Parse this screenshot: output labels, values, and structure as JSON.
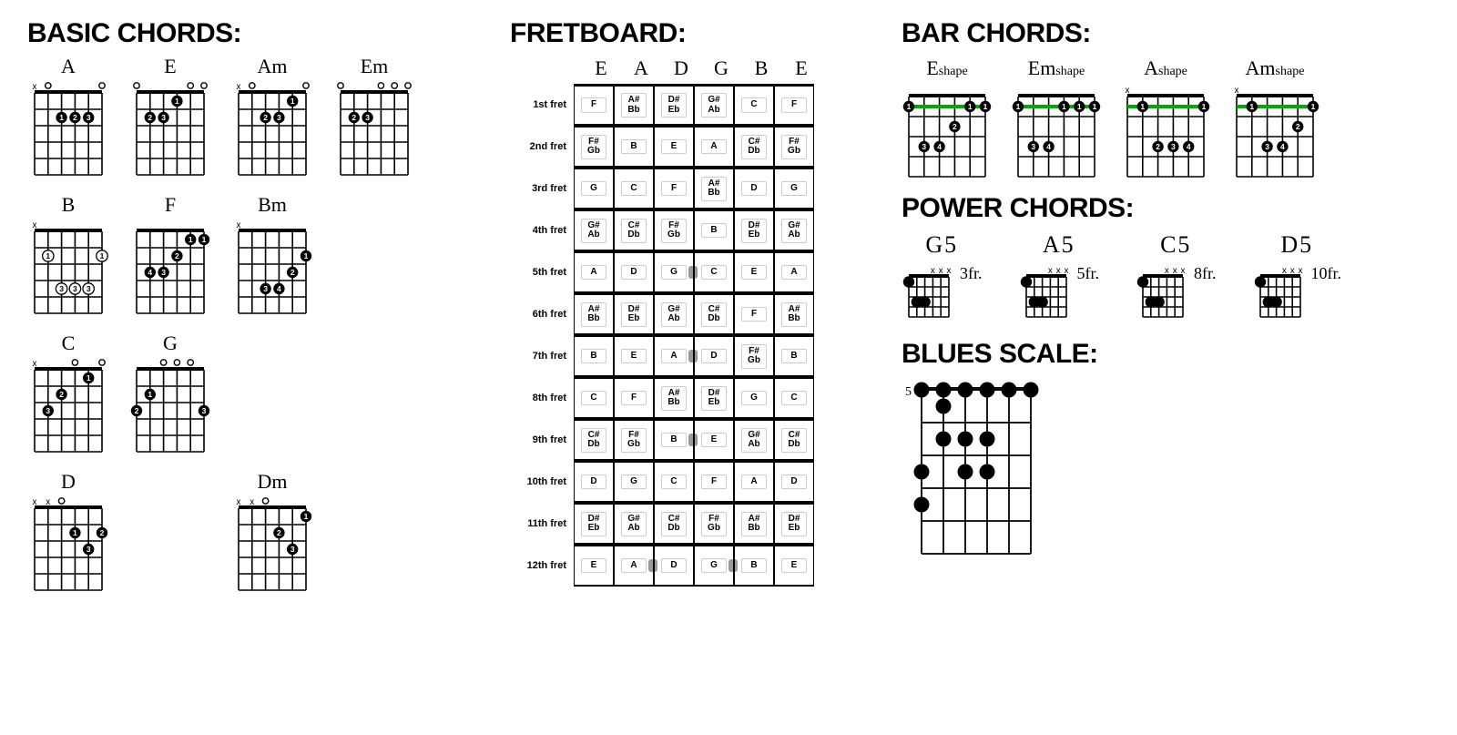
{
  "sections": {
    "basic": "BASIC CHORDS:",
    "fretboard": "FRETBOARD:",
    "bar": "BAR CHORDS:",
    "power": "POWER CHORDS:",
    "blues": "BLUES SCALE:"
  },
  "basic_chords": {
    "row1": [
      {
        "name": "A",
        "open": [
          "x",
          "o",
          "",
          "",
          "",
          "o"
        ],
        "dots": [
          [
            2,
            2,
            "1"
          ],
          [
            2,
            3,
            "2"
          ],
          [
            2,
            4,
            "3"
          ]
        ]
      },
      {
        "name": "E",
        "open": [
          "o",
          "",
          "",
          "",
          "o",
          "o"
        ],
        "dots": [
          [
            1,
            3,
            "1"
          ],
          [
            2,
            1,
            "2"
          ],
          [
            2,
            2,
            "3"
          ]
        ]
      },
      {
        "name": "Am",
        "open": [
          "x",
          "o",
          "",
          "",
          "",
          "o"
        ],
        "dots": [
          [
            1,
            4,
            "1"
          ],
          [
            2,
            2,
            "2"
          ],
          [
            2,
            3,
            "3"
          ]
        ]
      },
      {
        "name": "Em",
        "open": [
          "o",
          "",
          "",
          "o",
          "o",
          "o"
        ],
        "dots": [
          [
            2,
            1,
            "2"
          ],
          [
            2,
            2,
            "3"
          ]
        ]
      }
    ],
    "row2": [
      {
        "name": "B",
        "open": [
          "x",
          "",
          "",
          "",
          "",
          ""
        ],
        "style": "outline",
        "dots": [
          [
            2,
            1,
            "1"
          ],
          [
            2,
            5,
            "1"
          ],
          [
            4,
            2,
            "3"
          ],
          [
            4,
            3,
            "3"
          ],
          [
            4,
            4,
            "3"
          ]
        ]
      },
      {
        "name": "F",
        "open": [
          "",
          "",
          "",
          "",
          "",
          ""
        ],
        "dots": [
          [
            1,
            4,
            "1"
          ],
          [
            1,
            5,
            "1"
          ],
          [
            2,
            3,
            "2"
          ],
          [
            3,
            1,
            "4"
          ],
          [
            3,
            2,
            "3"
          ]
        ]
      },
      {
        "name": "Bm",
        "open": [
          "x",
          "",
          "",
          "",
          "",
          ""
        ],
        "dots": [
          [
            2,
            5,
            "1"
          ],
          [
            3,
            4,
            "2"
          ],
          [
            4,
            2,
            "3"
          ],
          [
            4,
            3,
            "4"
          ]
        ]
      }
    ],
    "row3": [
      {
        "name": "C",
        "open": [
          "x",
          "",
          "",
          "o",
          "",
          "o"
        ],
        "dots": [
          [
            1,
            4,
            "1"
          ],
          [
            2,
            2,
            "2"
          ],
          [
            3,
            1,
            "3"
          ]
        ]
      },
      {
        "name": "G",
        "open": [
          "",
          "",
          "o",
          "o",
          "o",
          ""
        ],
        "dots": [
          [
            2,
            1,
            "1"
          ],
          [
            3,
            0,
            "2"
          ],
          [
            3,
            5,
            "3"
          ]
        ]
      }
    ],
    "row4": [
      {
        "name": "D",
        "open": [
          "x",
          "x",
          "o",
          "",
          "",
          ""
        ],
        "dots": [
          [
            2,
            3,
            "1"
          ],
          [
            2,
            5,
            "2"
          ],
          [
            3,
            4,
            "3"
          ]
        ]
      },
      null,
      {
        "name": "Dm",
        "open": [
          "x",
          "x",
          "o",
          "",
          "",
          ""
        ],
        "dots": [
          [
            1,
            5,
            "1"
          ],
          [
            2,
            3,
            "2"
          ],
          [
            3,
            4,
            "3"
          ]
        ]
      }
    ]
  },
  "fretboard": {
    "open": [
      "E",
      "A",
      "D",
      "G",
      "B",
      "E"
    ],
    "rows": [
      {
        "label": "1st fret",
        "notes": [
          [
            "F"
          ],
          [
            "A#",
            "Bb"
          ],
          [
            "D#",
            "Eb"
          ],
          [
            "G#",
            "Ab"
          ],
          [
            "C"
          ],
          [
            "F"
          ]
        ]
      },
      {
        "label": "2nd fret",
        "notes": [
          [
            "F#",
            "Gb"
          ],
          [
            "B"
          ],
          [
            "E"
          ],
          [
            "A"
          ],
          [
            "C#",
            "Db"
          ],
          [
            "F#",
            "Gb"
          ]
        ]
      },
      {
        "label": "3rd fret",
        "notes": [
          [
            "G"
          ],
          [
            "C"
          ],
          [
            "F"
          ],
          [
            "A#",
            "Bb"
          ],
          [
            "D"
          ],
          [
            "G"
          ]
        ]
      },
      {
        "label": "4th fret",
        "notes": [
          [
            "G#",
            "Ab"
          ],
          [
            "C#",
            "Db"
          ],
          [
            "F#",
            "Gb"
          ],
          [
            "B"
          ],
          [
            "D#",
            "Eb"
          ],
          [
            "G#",
            "Ab"
          ]
        ]
      },
      {
        "label": "5th fret",
        "marker": [
          2.5
        ],
        "notes": [
          [
            "A"
          ],
          [
            "D"
          ],
          [
            "G"
          ],
          [
            "C"
          ],
          [
            "E"
          ],
          [
            "A"
          ]
        ]
      },
      {
        "label": "6th fret",
        "notes": [
          [
            "A#",
            "Bb"
          ],
          [
            "D#",
            "Eb"
          ],
          [
            "G#",
            "Ab"
          ],
          [
            "C#",
            "Db"
          ],
          [
            "F"
          ],
          [
            "A#",
            "Bb"
          ]
        ]
      },
      {
        "label": "7th fret",
        "marker": [
          2.5
        ],
        "notes": [
          [
            "B"
          ],
          [
            "E"
          ],
          [
            "A"
          ],
          [
            "D"
          ],
          [
            "F#",
            "Gb"
          ],
          [
            "B"
          ]
        ]
      },
      {
        "label": "8th fret",
        "notes": [
          [
            "C"
          ],
          [
            "F"
          ],
          [
            "A#",
            "Bb"
          ],
          [
            "D#",
            "Eb"
          ],
          [
            "G"
          ],
          [
            "C"
          ]
        ]
      },
      {
        "label": "9th fret",
        "marker": [
          2.5
        ],
        "notes": [
          [
            "C#",
            "Db"
          ],
          [
            "F#",
            "Gb"
          ],
          [
            "B"
          ],
          [
            "E"
          ],
          [
            "G#",
            "Ab"
          ],
          [
            "C#",
            "Db"
          ]
        ]
      },
      {
        "label": "10th fret",
        "notes": [
          [
            "D"
          ],
          [
            "G"
          ],
          [
            "C"
          ],
          [
            "F"
          ],
          [
            "A"
          ],
          [
            "D"
          ]
        ]
      },
      {
        "label": "11th fret",
        "notes": [
          [
            "D#",
            "Eb"
          ],
          [
            "G#",
            "Ab"
          ],
          [
            "C#",
            "Db"
          ],
          [
            "F#",
            "Gb"
          ],
          [
            "A#",
            "Bb"
          ],
          [
            "D#",
            "Eb"
          ]
        ]
      },
      {
        "label": "12th fret",
        "marker": [
          1.5,
          3.5
        ],
        "notes": [
          [
            "E"
          ],
          [
            "A"
          ],
          [
            "D"
          ],
          [
            "G"
          ],
          [
            "B"
          ],
          [
            "E"
          ]
        ]
      }
    ]
  },
  "bar_chords": [
    {
      "name": "E",
      "shape": "shape",
      "open": [
        "",
        "",
        "",
        "",
        "",
        ""
      ],
      "bar_fret": 1,
      "dots": [
        [
          1,
          0,
          "1"
        ],
        [
          1,
          4,
          "1"
        ],
        [
          1,
          5,
          "1"
        ],
        [
          2,
          3,
          "2"
        ],
        [
          3,
          1,
          "3"
        ],
        [
          3,
          2,
          "4"
        ]
      ]
    },
    {
      "name": "Em",
      "shape": "shape",
      "open": [
        "",
        "",
        "",
        "",
        "",
        ""
      ],
      "bar_fret": 1,
      "dots": [
        [
          1,
          0,
          "1"
        ],
        [
          1,
          3,
          "1"
        ],
        [
          1,
          4,
          "1"
        ],
        [
          1,
          5,
          "1"
        ],
        [
          3,
          1,
          "3"
        ],
        [
          3,
          2,
          "4"
        ]
      ]
    },
    {
      "name": "A",
      "shape": "shape",
      "open": [
        "x",
        "",
        "",
        "",
        "",
        ""
      ],
      "bar_fret": 1,
      "dots": [
        [
          1,
          1,
          "1"
        ],
        [
          1,
          5,
          "1"
        ],
        [
          3,
          2,
          "2"
        ],
        [
          3,
          3,
          "3"
        ],
        [
          3,
          4,
          "4"
        ]
      ]
    },
    {
      "name": "Am",
      "shape": "shape",
      "open": [
        "x",
        "",
        "",
        "",
        "",
        ""
      ],
      "bar_fret": 1,
      "dots": [
        [
          1,
          1,
          "1"
        ],
        [
          1,
          5,
          "1"
        ],
        [
          2,
          4,
          "2"
        ],
        [
          3,
          2,
          "3"
        ],
        [
          3,
          3,
          "4"
        ]
      ]
    }
  ],
  "power_chords": [
    {
      "name": "G5",
      "fret": "3fr.",
      "open": [
        "",
        "",
        "",
        "x",
        "x",
        "x"
      ],
      "dots": [
        [
          1,
          0
        ],
        [
          3,
          1
        ],
        [
          3,
          2
        ]
      ]
    },
    {
      "name": "A5",
      "fret": "5fr.",
      "open": [
        "",
        "",
        "",
        "x",
        "x",
        "x"
      ],
      "dots": [
        [
          1,
          0
        ],
        [
          3,
          1
        ],
        [
          3,
          2
        ]
      ]
    },
    {
      "name": "C5",
      "fret": "8fr.",
      "open": [
        "",
        "",
        "",
        "x",
        "x",
        "x"
      ],
      "dots": [
        [
          1,
          0
        ],
        [
          3,
          1
        ],
        [
          3,
          2
        ]
      ]
    },
    {
      "name": "D5",
      "fret": "10fr.",
      "open": [
        "",
        "",
        "",
        "x",
        "x",
        "x"
      ],
      "dots": [
        [
          1,
          0
        ],
        [
          3,
          1
        ],
        [
          3,
          2
        ]
      ]
    }
  ],
  "blues_scale": {
    "side_label": "5",
    "frets": 5,
    "dots": [
      [
        0,
        0
      ],
      [
        0,
        1
      ],
      [
        0,
        2
      ],
      [
        0,
        3
      ],
      [
        0,
        4
      ],
      [
        0,
        5
      ],
      [
        1,
        1
      ],
      [
        2,
        1
      ],
      [
        2,
        2
      ],
      [
        2,
        3
      ],
      [
        3,
        0
      ],
      [
        3,
        2
      ],
      [
        3,
        3
      ],
      [
        4,
        0
      ]
    ]
  }
}
